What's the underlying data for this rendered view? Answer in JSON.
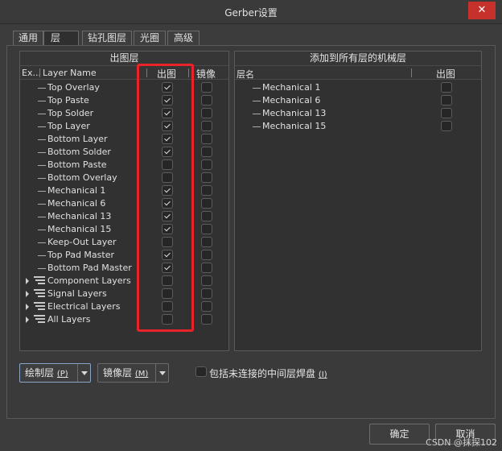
{
  "window": {
    "title": "Gerber设置",
    "close_glyph": "✕"
  },
  "tabs": [
    {
      "label": "通用"
    },
    {
      "label": "层"
    },
    {
      "label": "钻孔图层"
    },
    {
      "label": "光圈"
    },
    {
      "label": "高级"
    }
  ],
  "active_tab": "层",
  "plot_panel": {
    "title": "出图层",
    "col_expand": "Ex...",
    "col_name": "Layer Name",
    "col_plot": "出图",
    "col_mirror": "镜像",
    "layers": [
      {
        "name": "Top Overlay",
        "plot": true,
        "mirror": false
      },
      {
        "name": "Top Paste",
        "plot": true,
        "mirror": false
      },
      {
        "name": "Top Solder",
        "plot": true,
        "mirror": false
      },
      {
        "name": "Top Layer",
        "plot": true,
        "mirror": false
      },
      {
        "name": "Bottom Layer",
        "plot": true,
        "mirror": false
      },
      {
        "name": "Bottom Solder",
        "plot": true,
        "mirror": false
      },
      {
        "name": "Bottom Paste",
        "plot": false,
        "mirror": false
      },
      {
        "name": "Bottom Overlay",
        "plot": false,
        "mirror": false
      },
      {
        "name": "Mechanical 1",
        "plot": true,
        "mirror": false
      },
      {
        "name": "Mechanical 6",
        "plot": true,
        "mirror": false
      },
      {
        "name": "Mechanical 13",
        "plot": true,
        "mirror": false
      },
      {
        "name": "Mechanical 15",
        "plot": true,
        "mirror": false
      },
      {
        "name": "Keep-Out Layer",
        "plot": false,
        "mirror": false
      },
      {
        "name": "Top Pad Master",
        "plot": true,
        "mirror": false
      },
      {
        "name": "Bottom Pad Master",
        "plot": true,
        "mirror": false
      }
    ],
    "groups": [
      {
        "name": "Component Layers",
        "plot": false,
        "mirror": false
      },
      {
        "name": "Signal Layers",
        "plot": false,
        "mirror": false
      },
      {
        "name": "Electrical Layers",
        "plot": false,
        "mirror": false
      },
      {
        "name": "All Layers",
        "plot": false,
        "mirror": false
      }
    ]
  },
  "mech_panel": {
    "title": "添加到所有层的机械层",
    "col_name": "层名",
    "col_plot": "出图",
    "layers": [
      {
        "name": "Mechanical 1",
        "plot": false
      },
      {
        "name": "Mechanical 6",
        "plot": false
      },
      {
        "name": "Mechanical 13",
        "plot": false
      },
      {
        "name": "Mechanical 15",
        "plot": false
      }
    ]
  },
  "controls": {
    "plot_layers_label": "绘制层",
    "plot_layers_hotkey": "(P)",
    "mirror_layers_label": "镜像层",
    "mirror_layers_hotkey": "(M)",
    "include_pads_label": "包括未连接的中间层焊盘",
    "include_pads_hotkey": "(I)",
    "include_pads_checked": false
  },
  "footer": {
    "ok_label": "确定",
    "cancel_label": "取消"
  },
  "watermark": "CSDN @抹探102",
  "colors": {
    "highlight": "#e8242a",
    "close_button": "#c7312b"
  }
}
